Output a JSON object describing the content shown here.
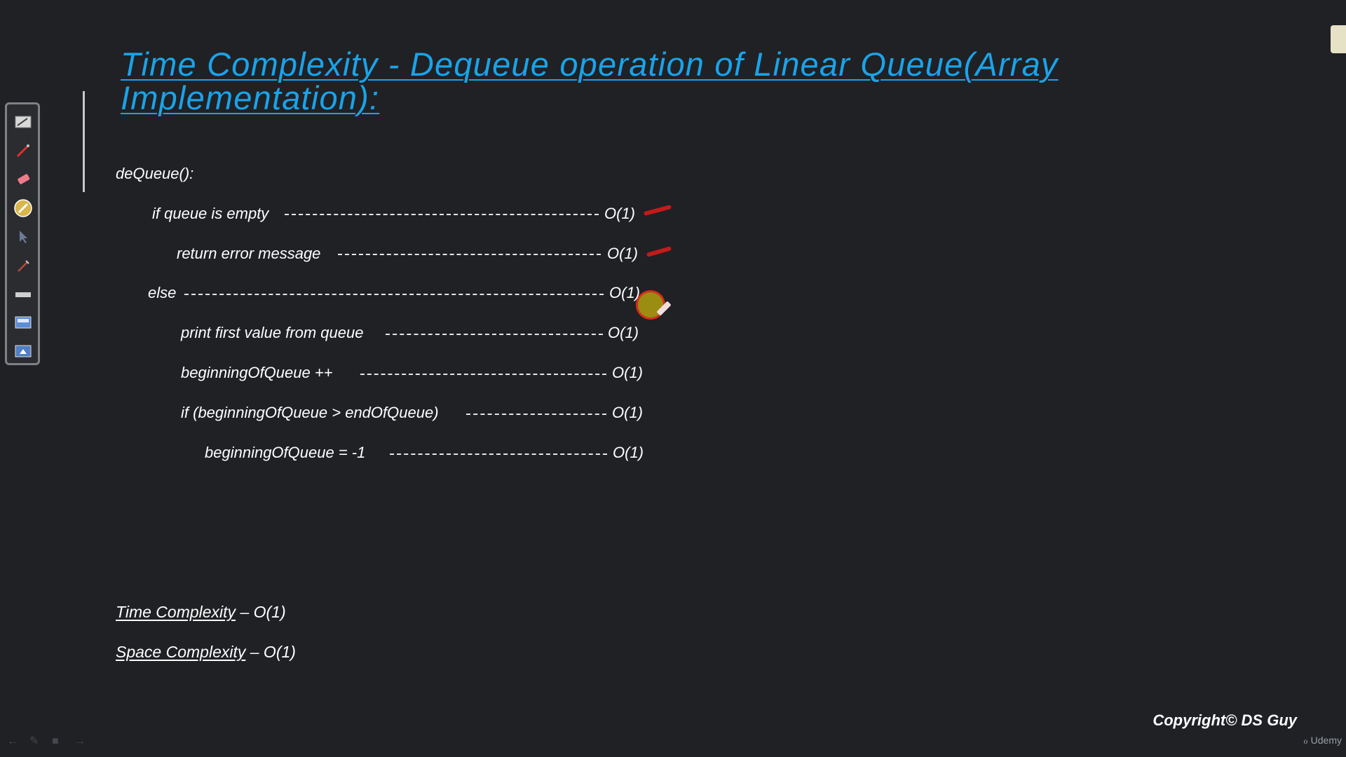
{
  "slide": {
    "title_lines": [
      "Time Complexity - Dequeue operation of Linear Queue(Array",
      "Implementation):"
    ],
    "function_name": "deQueue():",
    "code_lines": [
      {
        "text": "if queue is empty",
        "complexity": "O(1)",
        "marked": true
      },
      {
        "text": "return error message",
        "complexity": "O(1)",
        "marked": true
      },
      {
        "text": "else",
        "complexity": "O(1)",
        "marked": false
      },
      {
        "text": "print first value from queue",
        "complexity": "O(1)",
        "marked": false
      },
      {
        "text": "beginningOfQueue ++",
        "complexity": "O(1)",
        "marked": false
      },
      {
        "text": "if (beginningOfQueue > endOfQueue)",
        "complexity": "O(1)",
        "marked": false
      },
      {
        "text": "beginningOfQueue = -1",
        "complexity": "O(1)",
        "marked": false
      }
    ],
    "summary": {
      "time_label": "Time Complexity",
      "time_value": "– O(1)",
      "space_label": "Space Complexity",
      "space_value": "– O(1)"
    },
    "copyright": "Copyright© DS Guy",
    "brand": "Udemy"
  },
  "colors": {
    "background": "#1f2125",
    "title": "#1aa3e8",
    "annotation": "#c41a1a",
    "text": "#ffffff"
  },
  "toolbar": {
    "tools": [
      "whiteboard-icon",
      "pen-icon",
      "eraser-icon",
      "highlighter-icon",
      "pointer-icon",
      "marker-icon",
      "line-icon",
      "screen-icon",
      "capture-icon"
    ]
  }
}
